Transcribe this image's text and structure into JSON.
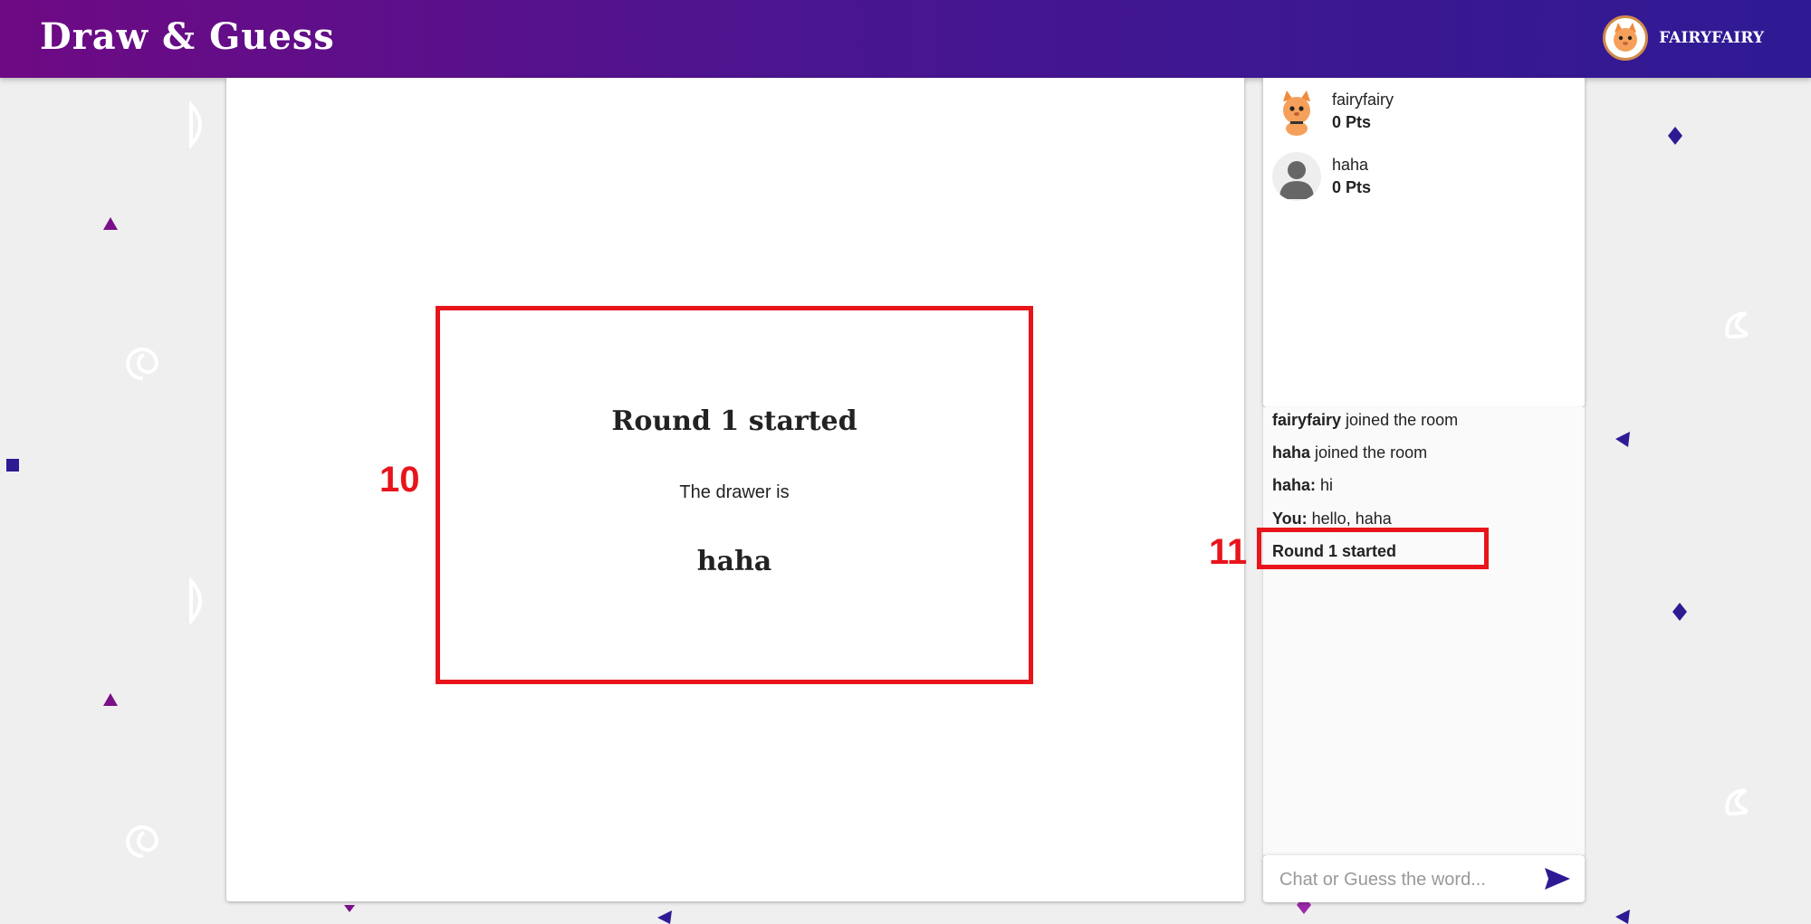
{
  "header": {
    "brand": "Draw & Guess",
    "user_name": "FAIRYFAIRY",
    "avatar_icon": "cat-avatar-icon"
  },
  "canvas": {
    "round_title": "Round 1 started",
    "drawer_label": "The drawer is",
    "drawer_name": "haha"
  },
  "annotations": {
    "label_10": "10",
    "label_11": "11"
  },
  "players": [
    {
      "name": "fairyfairy",
      "points": "0 Pts",
      "avatar": "cat-avatar-icon"
    },
    {
      "name": "haha",
      "points": "0 Pts",
      "avatar": "default-user-icon"
    }
  ],
  "chat": {
    "messages": [
      {
        "sender": "fairyfairy",
        "text": " joined the room"
      },
      {
        "sender": "haha",
        "text": " joined the room"
      },
      {
        "sender": "haha:",
        "text": " hi"
      },
      {
        "sender": "You:",
        "text": " hello, haha"
      },
      {
        "sender": "Round 1 started",
        "text": ""
      }
    ],
    "placeholder": "Chat or Guess the word...",
    "send_icon": "send-icon"
  },
  "colors": {
    "header_start": "#6e0a84",
    "header_end": "#2f1a94",
    "highlight": "#e8141b"
  }
}
